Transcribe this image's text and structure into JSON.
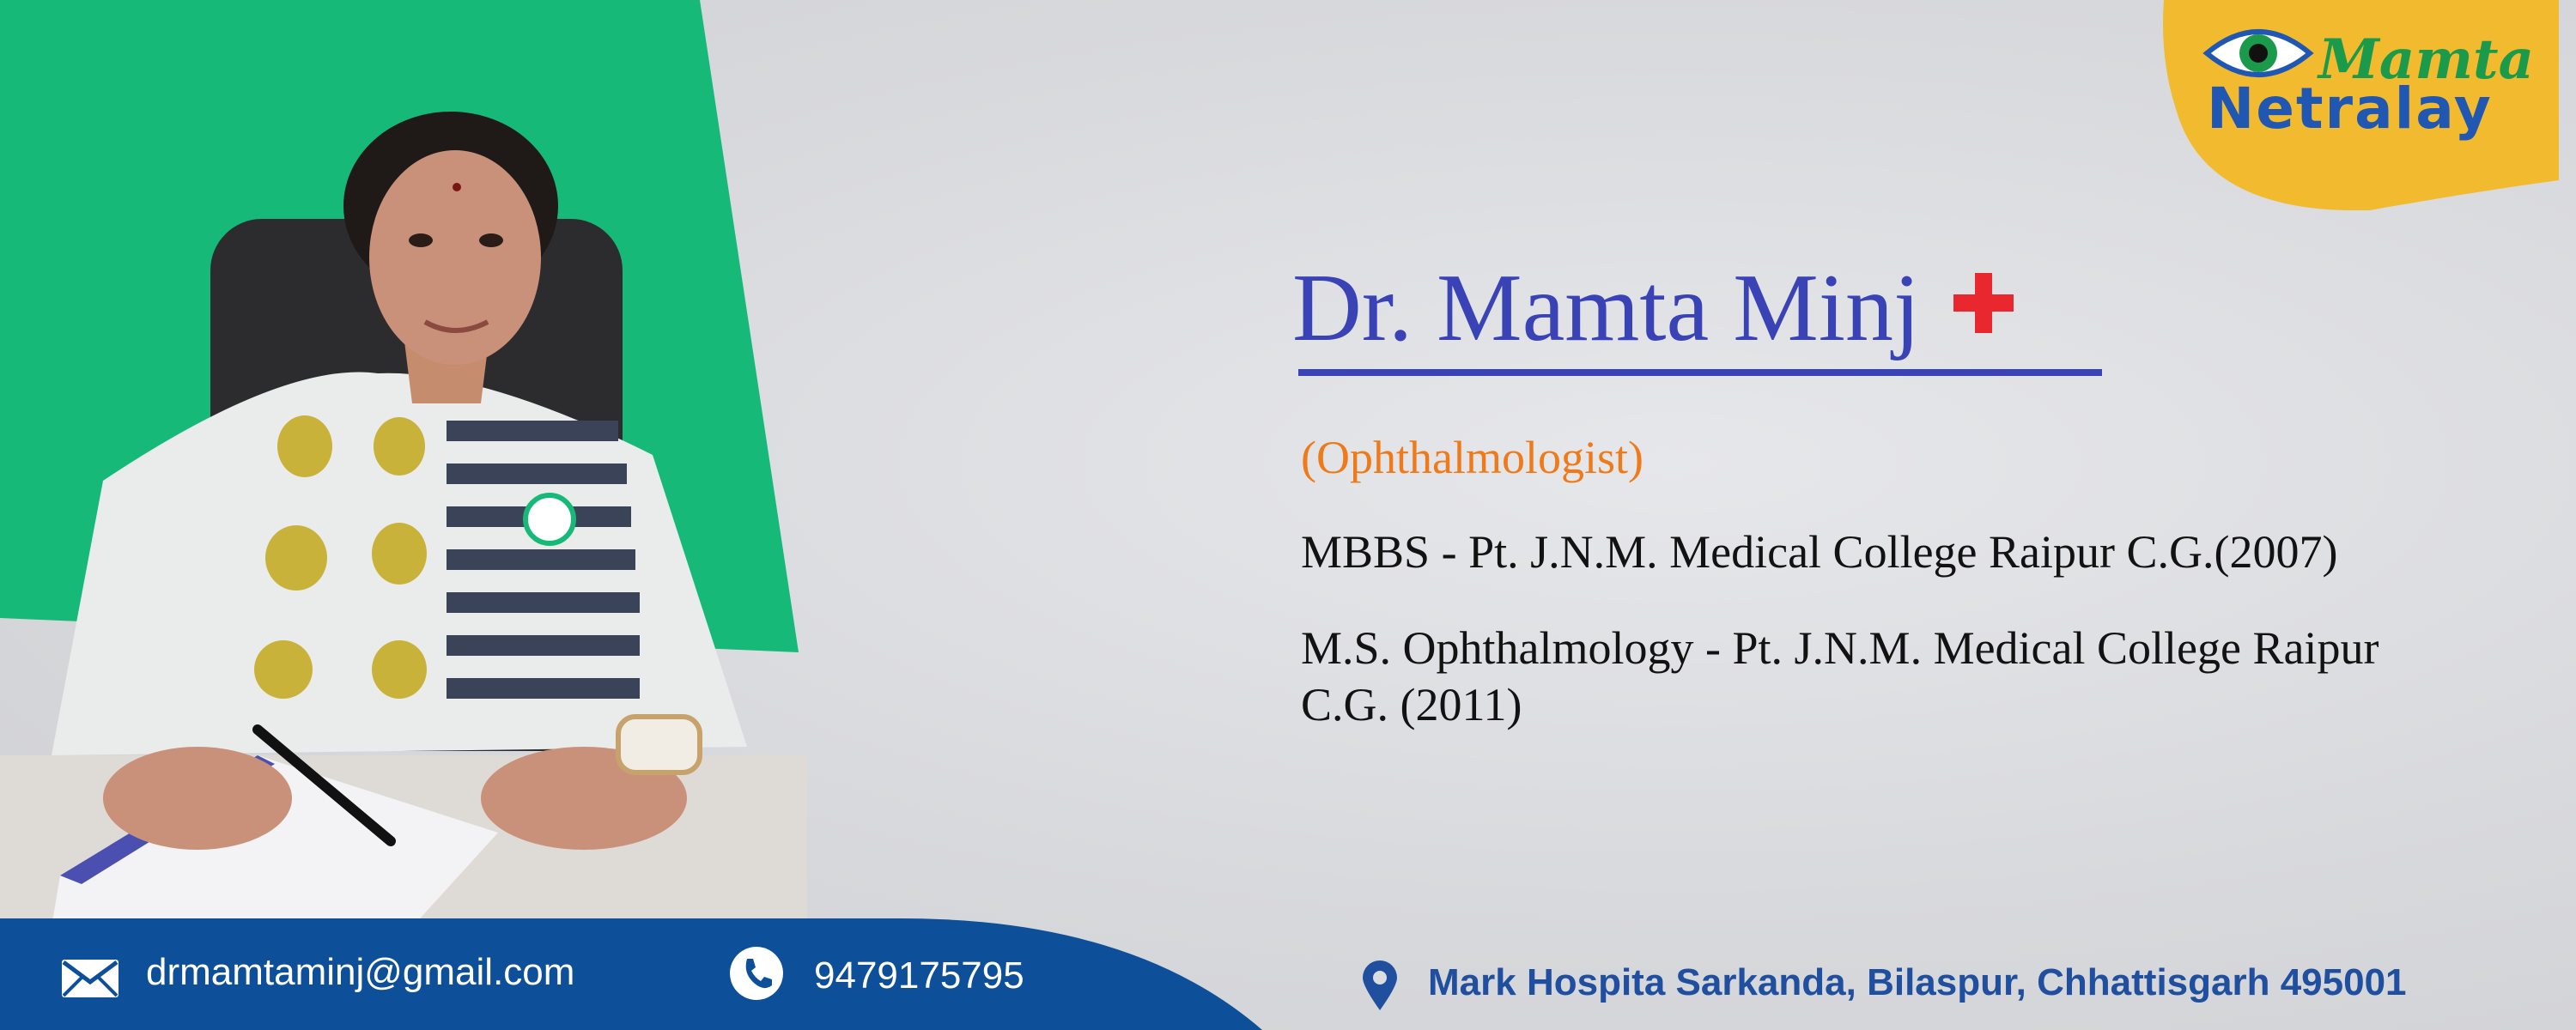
{
  "brand": {
    "logo_line1": "Mamta",
    "logo_line2": "Netralay",
    "colors": {
      "primary_blue": "#3a43b5",
      "green": "#17b978",
      "yellow": "#f2ba2e",
      "orange": "#ef7a1a",
      "footer_blue": "#0d4f98",
      "red": "#e8282e"
    }
  },
  "doctor": {
    "name": "Dr. Mamta Minj",
    "specialty": "(Ophthalmologist)",
    "education": [
      "MBBS - Pt. J.N.M. Medical College Raipur C.G.(2007)",
      "M.S. Ophthalmology - Pt. J.N.M. Medical College Raipur C.G. (2011)"
    ]
  },
  "contact": {
    "email": "drmamtaminj@gmail.com",
    "phone": "9479175795",
    "address": "Mark Hospita Sarkanda, Bilaspur, Chhattisgarh 495001"
  },
  "icons": [
    "eye-logo-icon",
    "medical-cross-icon",
    "email-icon",
    "phone-icon",
    "location-pin-icon"
  ]
}
